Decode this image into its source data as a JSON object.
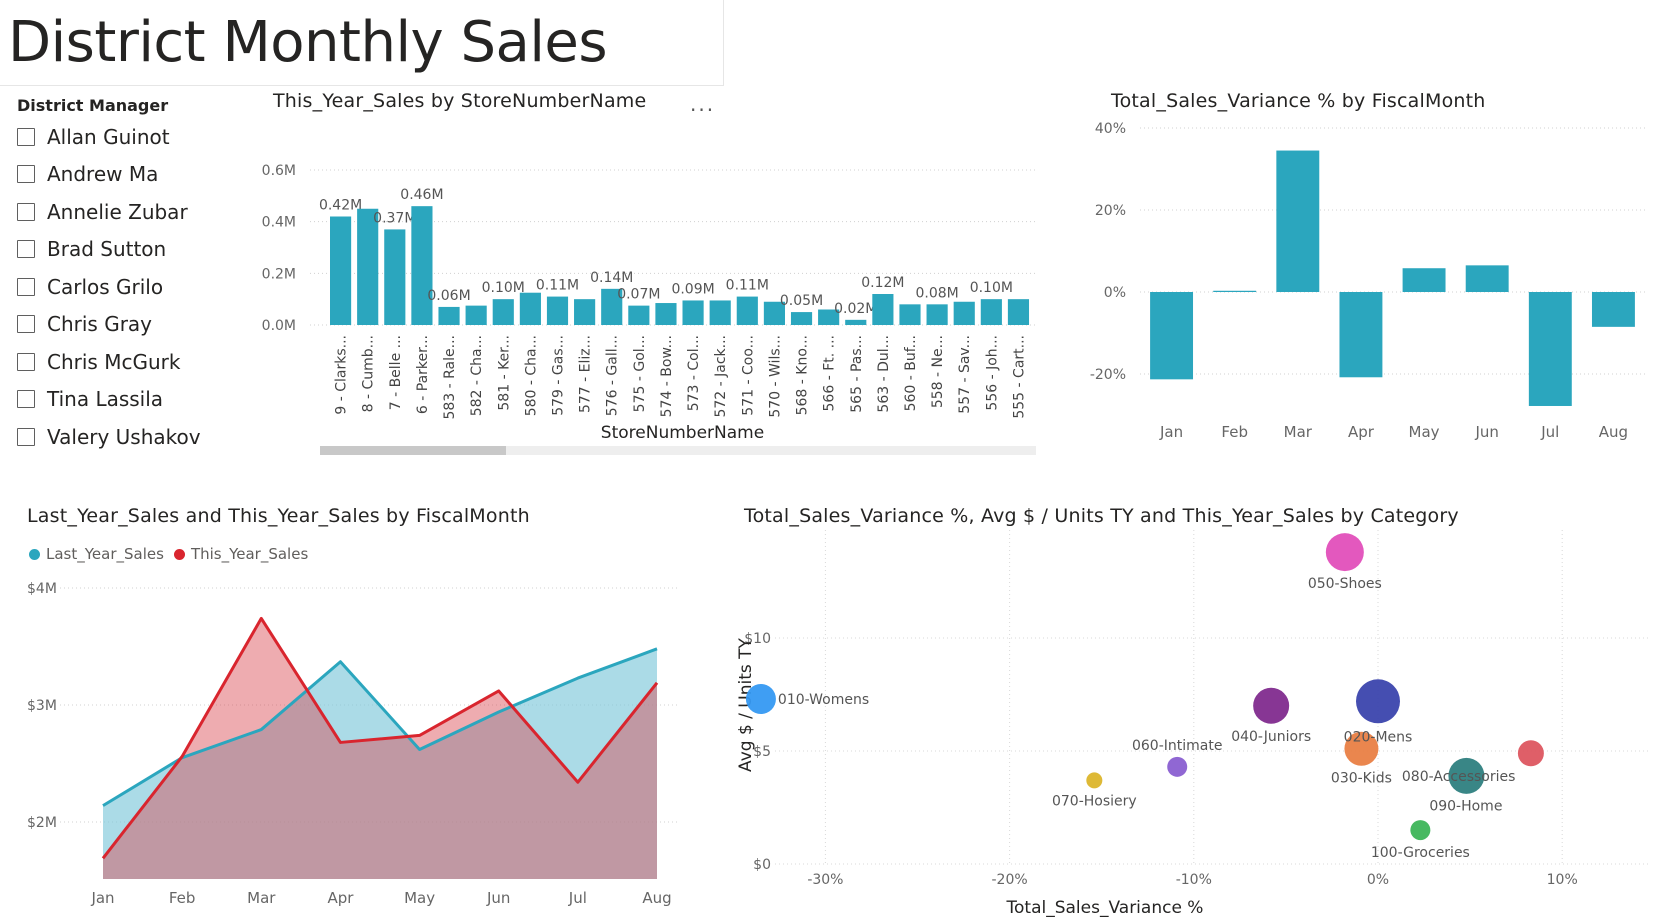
{
  "page": {
    "title": "District Monthly Sales"
  },
  "slicer": {
    "header": "District Manager",
    "items": [
      "Allan Guinot",
      "Andrew Ma",
      "Annelie Zubar",
      "Brad Sutton",
      "Carlos Grilo",
      "Chris Gray",
      "Chris McGurk",
      "Tina Lassila",
      "Valery Ushakov"
    ]
  },
  "more_options": "...",
  "colors": {
    "teal": "#2ba6be",
    "red": "#d9252e",
    "teal_fill": "#a7d8e3",
    "red_fill": "#eea3a7"
  },
  "chart_data": [
    {
      "id": "store_bar",
      "type": "bar",
      "title": "This_Year_Sales by StoreNumberName",
      "xlabel": "StoreNumberName",
      "ylabel": "",
      "yticks": [
        "0.0M",
        "0.2M",
        "0.4M",
        "0.6M"
      ],
      "ylim": [
        0,
        0.6
      ],
      "categories": [
        "9 - Clarks...",
        "8 - Cumb...",
        "7 - Belle ...",
        "6 - Parker...",
        "583 - Rale...",
        "582 - Cha...",
        "581 - Ker...",
        "580 - Cha...",
        "579 - Gas...",
        "577 - Eliz...",
        "576 - Gall...",
        "575 - Gol...",
        "574 - Bow...",
        "573 - Col...",
        "572 - Jack...",
        "571 - Coo...",
        "570 - Wils...",
        "568 - Kno...",
        "566 - Ft. ...",
        "565 - Pas...",
        "563 - Dul...",
        "560 - Buf...",
        "558 - Ne...",
        "557 - Sav...",
        "556 - Joh...",
        "555 - Cart..."
      ],
      "values": [
        0.42,
        0.45,
        0.37,
        0.46,
        0.07,
        0.075,
        0.1,
        0.125,
        0.11,
        0.1,
        0.14,
        0.075,
        0.085,
        0.095,
        0.095,
        0.11,
        0.09,
        0.05,
        0.06,
        0.02,
        0.12,
        0.08,
        0.08,
        0.09,
        0.1,
        0.1
      ],
      "data_labels": [
        "0.42M",
        "",
        "0.37M",
        "0.46M",
        "0.06M",
        "",
        "0.10M",
        "",
        "0.11M",
        "",
        "0.14M",
        "0.07M",
        "",
        "0.09M",
        "",
        "0.11M",
        "",
        "0.05M",
        "",
        "0.02M",
        "0.12M",
        "",
        "0.08M",
        "",
        "0.10M",
        ""
      ]
    },
    {
      "id": "variance_bar",
      "type": "bar",
      "title": "Total_Sales_Variance % by FiscalMonth",
      "yticks": [
        "40%",
        "20%",
        "0%",
        "-20%"
      ],
      "ylim": [
        -30,
        40
      ],
      "categories": [
        "Jan",
        "Feb",
        "Mar",
        "Apr",
        "May",
        "Jun",
        "Jul",
        "Aug"
      ],
      "values": [
        -21.3,
        0.3,
        34.5,
        -20.8,
        5.8,
        6.5,
        -27.8,
        -8.5
      ]
    },
    {
      "id": "sales_area",
      "type": "area",
      "title": "Last_Year_Sales and This_Year_Sales by FiscalMonth",
      "yticks": [
        "$2M",
        "$3M",
        "$4M"
      ],
      "ylim": [
        1.5,
        4.0
      ],
      "categories": [
        "Jan",
        "Feb",
        "Mar",
        "Apr",
        "May",
        "Jun",
        "Jul",
        "Aug"
      ],
      "series": [
        {
          "name": "Last_Year_Sales",
          "values": [
            2.14,
            2.55,
            2.79,
            3.37,
            2.62,
            2.94,
            3.23,
            3.48
          ]
        },
        {
          "name": "This_Year_Sales",
          "values": [
            1.69,
            2.56,
            3.74,
            2.68,
            2.74,
            3.12,
            2.34,
            3.19
          ]
        }
      ]
    },
    {
      "id": "category_scatter",
      "type": "scatter",
      "title": "Total_Sales_Variance %, Avg $ / Units TY and This_Year_Sales by Category",
      "xlabel": "Total_Sales_Variance %",
      "ylabel": "Avg $ / Units TY",
      "xticks": [
        "-30%",
        "-20%",
        "-10%",
        "0%",
        "10%"
      ],
      "yticks": [
        "$0",
        "$5",
        "$10"
      ],
      "xlim": [
        -36,
        10
      ],
      "ylim": [
        0,
        13.5
      ],
      "points": [
        {
          "label": "010-Womens",
          "x": -33.5,
          "y": 7.3,
          "size": 15,
          "color": "#3599f2"
        },
        {
          "label": "050-Shoes",
          "x": -1.8,
          "y": 13.8,
          "size": 19,
          "color": "#e14fba"
        },
        {
          "label": "040-Juniors",
          "x": -5.8,
          "y": 7.0,
          "size": 18,
          "color": "#812b8e"
        },
        {
          "label": "020-Mens",
          "x": 0.0,
          "y": 7.2,
          "size": 22,
          "color": "#3b44ad"
        },
        {
          "label": "030-Kids",
          "x": -0.9,
          "y": 5.1,
          "size": 17,
          "color": "#e97f45"
        },
        {
          "label": "060-Intimate",
          "x": -10.9,
          "y": 4.3,
          "size": 10,
          "color": "#8a5fd1"
        },
        {
          "label": "070-Hosiery",
          "x": -15.4,
          "y": 3.7,
          "size": 8,
          "color": "#dcb52b"
        },
        {
          "label": "080-Accessories",
          "x": 4.8,
          "y": 3.9,
          "size": 18,
          "color": "#2e7f7f"
        },
        {
          "label": "090-Home",
          "x": 8.3,
          "y": 4.9,
          "size": 13,
          "color": "#dd5660"
        },
        {
          "label": "100-Groceries",
          "x": 2.3,
          "y": 1.5,
          "size": 10,
          "color": "#3db559"
        }
      ]
    }
  ]
}
